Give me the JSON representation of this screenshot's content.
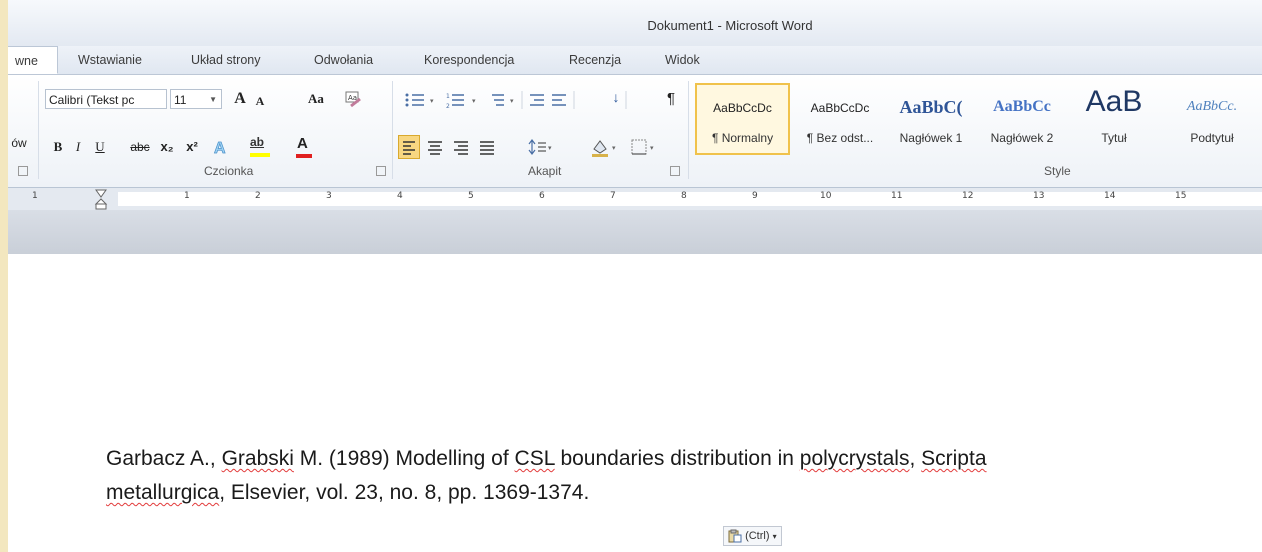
{
  "window": {
    "title": "Dokument1 - Microsoft Word"
  },
  "tabs": [
    {
      "label": "wne"
    },
    {
      "label": "Wstawianie"
    },
    {
      "label": "Układ strony"
    },
    {
      "label": "Odwołania"
    },
    {
      "label": "Korespondencja"
    },
    {
      "label": "Recenzja"
    },
    {
      "label": "Widok"
    }
  ],
  "ribbon": {
    "clipboard_partial": "ów",
    "font_name": "Calibri (Tekst pc",
    "font_size": "11",
    "groups": {
      "font": "Czcionka",
      "paragraph": "Akapit",
      "styles": "Style"
    },
    "buttons": {
      "bold": "B",
      "italic": "I",
      "underline": "U",
      "strike": "abc",
      "subscript": "x₂",
      "superscript": "x²",
      "grow_font": "A",
      "shrink_font": "A",
      "change_case": "Aa",
      "sort": "↓",
      "pilcrow": "¶",
      "highlight": "ab",
      "font_color": "A"
    },
    "styles": [
      {
        "sample": "AaBbCcDc",
        "name": "¶ Normalny",
        "selected": true
      },
      {
        "sample": "AaBbCcDc",
        "name": "¶ Bez odst..."
      },
      {
        "sample": "AaBbC(",
        "name": "Nagłówek 1"
      },
      {
        "sample": "AaBbCc",
        "name": "Nagłówek 2"
      },
      {
        "sample": "AaB",
        "name": "Tytuł"
      },
      {
        "sample": "AaBbCc.",
        "name": "Podtytuł"
      }
    ]
  },
  "ruler": {
    "numbers": [
      "1",
      "1",
      "2",
      "3",
      "4",
      "5",
      "6",
      "7",
      "8",
      "9",
      "10",
      "11",
      "12",
      "13",
      "14",
      "15"
    ]
  },
  "document": {
    "line1_parts": [
      "Garbacz A., ",
      "Grabski",
      " M. (1989) Modelling of ",
      "CSL",
      " boundaries distribution in ",
      "polycrystals",
      ", ",
      "Scripta"
    ],
    "line2_parts": [
      "metallurgica",
      ", Elsevier, vol. 23, no. 8, pp. 1369-1374."
    ]
  },
  "paste_options": {
    "label": "(Ctrl)"
  },
  "colors": {
    "accent": "#2b579a",
    "heading": "#2f5597",
    "spell": "#e23b3b",
    "selected_style": "#f0c24b"
  }
}
